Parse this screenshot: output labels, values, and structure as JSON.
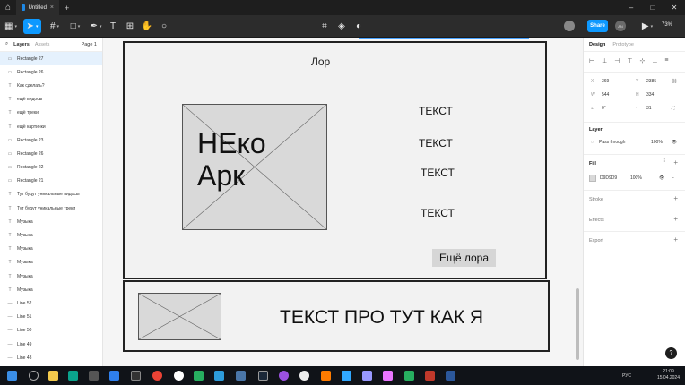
{
  "titlebar": {
    "tab_title": "Untitled",
    "close": "×",
    "new_tab": "+"
  },
  "toolbar": {
    "share_label": "Share",
    "zoom": "73%",
    "user_initials": "AN"
  },
  "left_panel": {
    "tabs": {
      "layers": "Layers",
      "assets": "Assets",
      "page": "Page 1"
    },
    "layers": [
      {
        "icon": "rect",
        "name": "Rectangle 27",
        "selected": true
      },
      {
        "icon": "rect",
        "name": "Rectangle 26"
      },
      {
        "icon": "text",
        "name": "Как сделать?"
      },
      {
        "icon": "text",
        "name": "ещё видосы"
      },
      {
        "icon": "text",
        "name": "ещё треки"
      },
      {
        "icon": "text",
        "name": "ещё картинки"
      },
      {
        "icon": "rect",
        "name": "Rectangle 23"
      },
      {
        "icon": "rect",
        "name": "Rectangle 26"
      },
      {
        "icon": "rect",
        "name": "Rectangle 22"
      },
      {
        "icon": "rect",
        "name": "Rectangle 21"
      },
      {
        "icon": "text",
        "name": "Тут будут уникальные видосы"
      },
      {
        "icon": "text",
        "name": "Тут будут уникальные треки"
      },
      {
        "icon": "text",
        "name": "Музыка"
      },
      {
        "icon": "text",
        "name": "Музыка"
      },
      {
        "icon": "text",
        "name": "Музыка"
      },
      {
        "icon": "text",
        "name": "Музыка"
      },
      {
        "icon": "text",
        "name": "Музыка"
      },
      {
        "icon": "text",
        "name": "Музыка"
      },
      {
        "icon": "line",
        "name": "Line 52"
      },
      {
        "icon": "line",
        "name": "Line 51"
      },
      {
        "icon": "line",
        "name": "Line 50"
      },
      {
        "icon": "line",
        "name": "Line 49"
      },
      {
        "icon": "line",
        "name": "Line 48"
      }
    ]
  },
  "canvas": {
    "lor_title": "Лор",
    "neko_line1": "НЕко",
    "neko_line2": "Арк",
    "texts": [
      "ТЕКСТ",
      "ТЕКСТ",
      "ТЕКСТ",
      "ТЕКСТ"
    ],
    "more_button": "Ещё лора",
    "bottom_text": "ТЕКСТ ПРО ТУТ КАК Я"
  },
  "right_panel": {
    "tabs": {
      "design": "Design",
      "prototype": "Prototype"
    },
    "x": "369",
    "y": "2385",
    "w": "544",
    "h": "334",
    "rotation": "0°",
    "radius": "31",
    "layer_section": "Layer",
    "blend_mode": "Pass through",
    "layer_opacity": "100%",
    "fill_section": "Fill",
    "fill_hex": "D9D9D9",
    "fill_opacity": "100%",
    "stroke_section": "Stroke",
    "effects_section": "Effects",
    "export_section": "Export",
    "help": "?"
  },
  "taskbar": {
    "lang": "РУС",
    "time": "21:09",
    "date": "15.04.2024"
  }
}
